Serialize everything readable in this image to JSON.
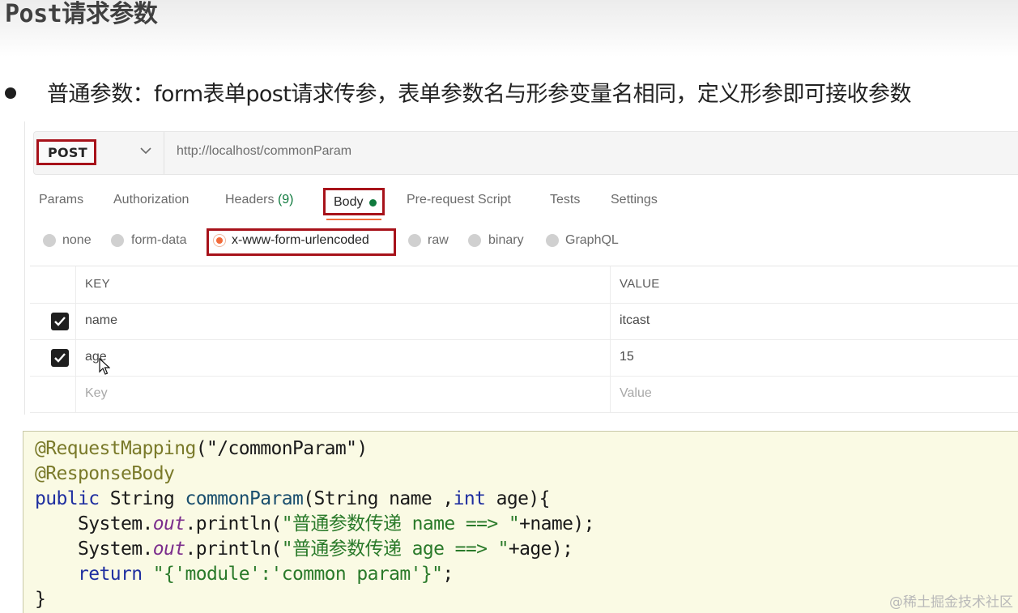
{
  "page": {
    "title": "Post请求参数",
    "bullet_text": "普通参数：form表单post请求传参，表单参数名与形参变量名相同，定义形参即可接收参数"
  },
  "request": {
    "method": "POST",
    "url": "http://localhost/commonParam"
  },
  "tabs": {
    "params": "Params",
    "authorization": "Authorization",
    "headers": "Headers",
    "headers_count": "(9)",
    "body": "Body",
    "pre_request": "Pre-request Script",
    "tests": "Tests",
    "settings": "Settings"
  },
  "body_types": {
    "none": "none",
    "form_data": "form-data",
    "urlencoded": "x-www-form-urlencoded",
    "raw": "raw",
    "binary": "binary",
    "graphql": "GraphQL",
    "selected": "x-www-form-urlencoded"
  },
  "kv_table": {
    "key_header": "KEY",
    "value_header": "VALUE",
    "rows": [
      {
        "key": "name",
        "value": "itcast",
        "checked": true
      },
      {
        "key": "age",
        "value": "15",
        "checked": true
      }
    ],
    "key_placeholder": "Key",
    "value_placeholder": "Value"
  },
  "code": {
    "l1_ann": "@RequestMapping",
    "l1_rest": "(\"/commonParam\")",
    "l2_ann": "@ResponseBody",
    "l3_kw": "public",
    "l3_type": " String ",
    "l3_fn": "commonParam",
    "l3_rest": "(String name ,",
    "l3_kw2": "int",
    "l3_end": " age){",
    "l4_pre": "    System.",
    "l4_out": "out",
    "l4_mid": ".println(",
    "l4_str": "\"普通参数传递 name ==> \"",
    "l4_end": "+name);",
    "l5_pre": "    System.",
    "l5_out": "out",
    "l5_mid": ".println(",
    "l5_str": "\"普通参数传递 age ==> \"",
    "l5_end": "+age);",
    "l6_kw": "    return",
    "l6_str": " \"{'module':'common param'}\"",
    "l6_end": ";",
    "l7": "}"
  },
  "watermark": "@稀土掘金技术社区",
  "colors": {
    "highlight_box": "#a7121a",
    "active_radio": "#f26b3a",
    "body_dot": "#0f7a3d",
    "code_bg": "#fafae4"
  }
}
